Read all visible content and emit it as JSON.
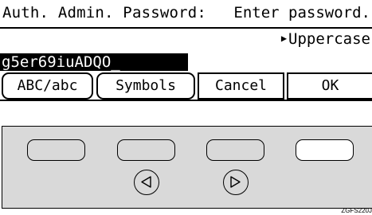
{
  "lcd": {
    "title": "Auth. Admin. Password:",
    "message": "Enter password.",
    "mode": "Uppercase",
    "entry_value": "g5er69iuADQO_",
    "softkeys": {
      "abc": "ABC/abc",
      "symbols": "Symbols",
      "cancel": "Cancel",
      "ok": "OK"
    }
  },
  "panel": {
    "left_arrow_icon": "left-triangle-icon",
    "right_arrow_icon": "right-triangle-icon"
  },
  "figure_code": "ZGFS220J"
}
